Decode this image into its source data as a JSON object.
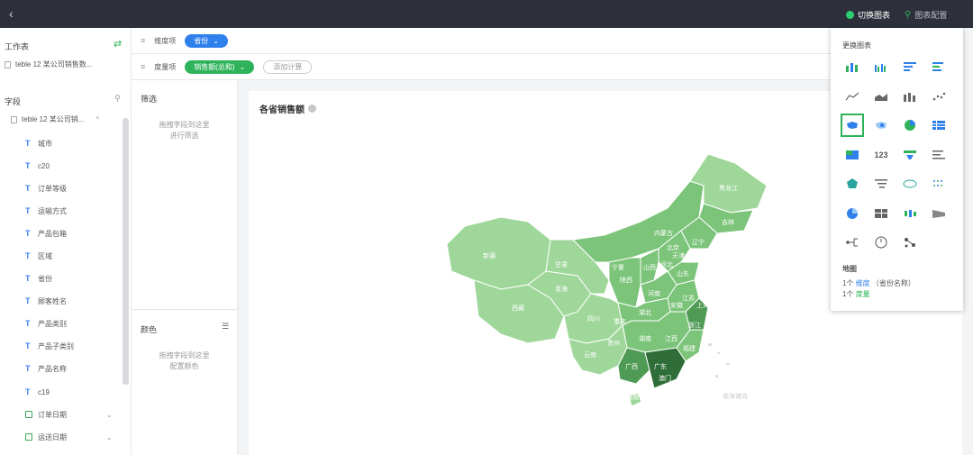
{
  "topbar": {
    "switch_chart_label": "切换图表",
    "chart_config_label": "图表配置"
  },
  "left": {
    "worksheet_title": "工作表",
    "sheet_name": "teble 12 某公司销售数...",
    "fields_title": "字段",
    "table_name": "teble 12 某公司销...",
    "fields": [
      "城市",
      "c20",
      "订单等级",
      "运输方式",
      "产品包箱",
      "区域",
      "省份",
      "顾客姓名",
      "产品类别",
      "产品子类别",
      "产品名称",
      "c19"
    ],
    "date_fields": [
      "订单日期",
      "运送日期"
    ]
  },
  "shelves": {
    "dimension_label": "维度项",
    "dimension_pill": "省份",
    "measure_label": "度量项",
    "measure_pill": "销售额(总和)",
    "add_calc": "添加计算"
  },
  "filter": {
    "title": "筛选",
    "hint_line1": "拖拽字段到这里",
    "hint_line2": "进行筛选",
    "color_title": "颜色",
    "color_hint_line1": "拖拽字段到这里",
    "color_hint_line2": "配置颜色"
  },
  "chart": {
    "title": "各省销售额",
    "provinces": [
      "黑龙江",
      "内蒙古",
      "吉林",
      "辽宁",
      "新疆",
      "甘肃",
      "北京",
      "天津",
      "河北",
      "宁夏",
      "山西",
      "山东",
      "青海",
      "陕西",
      "河南",
      "西藏",
      "江苏",
      "安徽",
      "上海",
      "四川",
      "湖北",
      "重庆",
      "浙江",
      "湖南",
      "江西",
      "贵州",
      "云南",
      "福建",
      "广西",
      "广东",
      "澳门",
      "海南",
      "南海诸岛"
    ],
    "colors": {
      "light": "#9fd79a",
      "mid": "#7cc47a",
      "dark": "#4f9a55",
      "darkest": "#2f6e38"
    }
  },
  "popup": {
    "title": "更换图表",
    "icons": [
      "bar-chart",
      "grouped-bar",
      "stacked-hbar",
      "hbar",
      "line-chart",
      "area-chart",
      "column-chart",
      "scatter-chart",
      "map-chart",
      "dot-map",
      "pie-chart",
      "cross-table",
      "heatmap",
      "number-card",
      "funnel",
      "ranking",
      "radar",
      "waterfall",
      "word-cloud",
      "dot-matrix",
      "donut",
      "tree-map",
      "boxplot",
      "sankey",
      "tree",
      "gauge",
      "relation"
    ],
    "number_label": "123",
    "map_title": "地图",
    "req_dim_prefix": "1个",
    "req_dim_link": "维度",
    "req_dim_suffix": "（省份名称）",
    "req_measure_prefix": "1个",
    "req_measure_link": "度量"
  }
}
